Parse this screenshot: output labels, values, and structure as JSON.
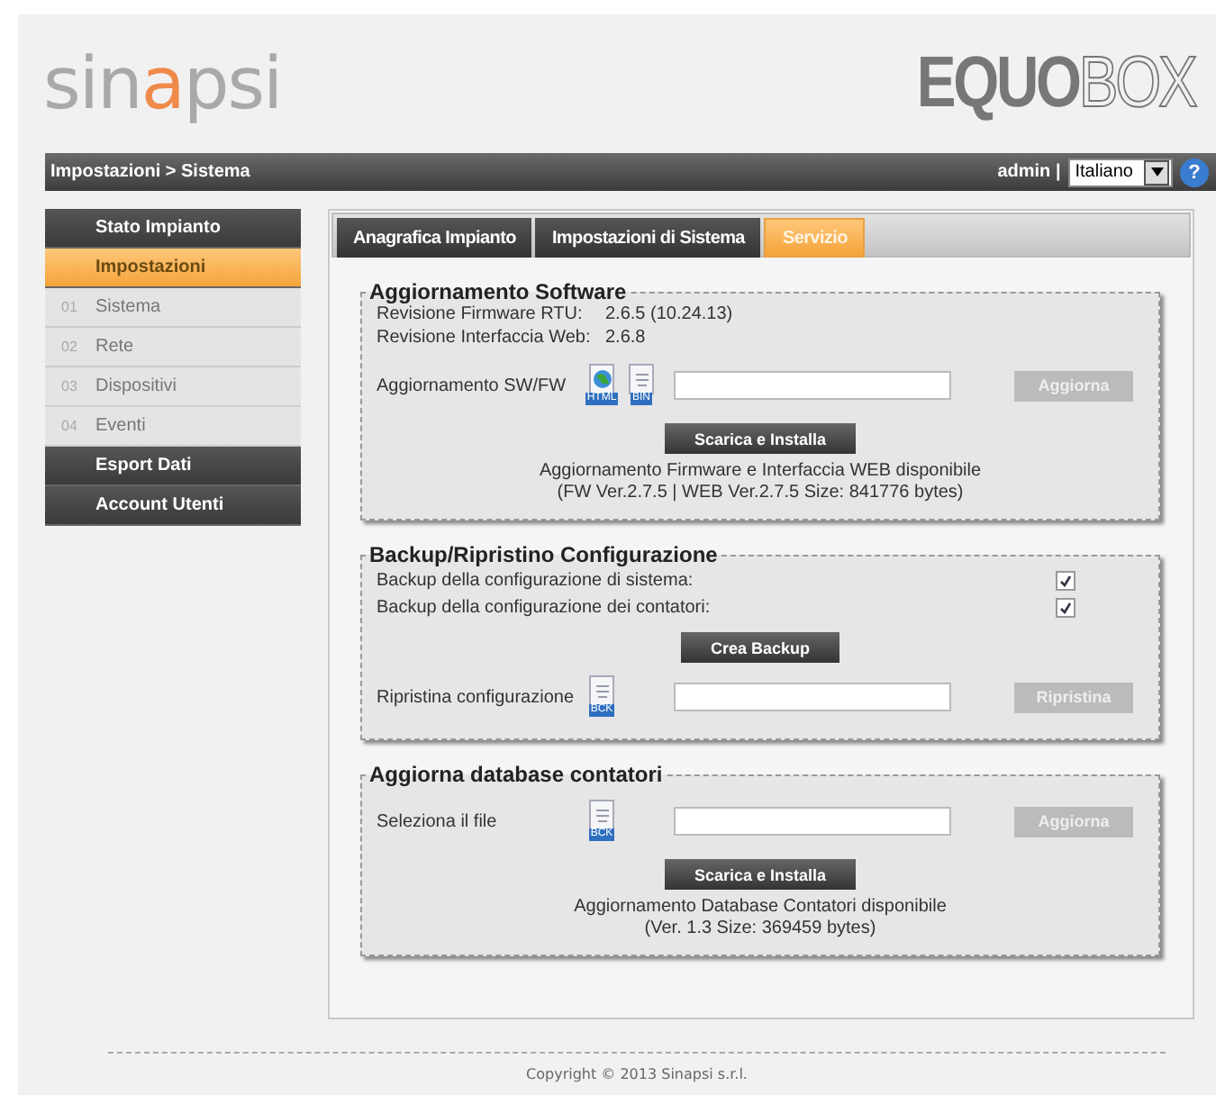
{
  "header": {
    "logo_parts": [
      "sin",
      "a",
      "psi"
    ],
    "product_parts": [
      "EQUO",
      "BOX"
    ]
  },
  "navbar": {
    "breadcrumb": "Impostazioni > Sistema",
    "user": "admin |",
    "language": "Italiano",
    "help": "?"
  },
  "sidebar": {
    "items": [
      {
        "kind": "header",
        "label": "Stato Impianto",
        "selected": false
      },
      {
        "kind": "header",
        "label": "Impostazioni",
        "selected": true
      },
      {
        "kind": "sub",
        "number": "01",
        "label": "Sistema",
        "selected": false
      },
      {
        "kind": "sub",
        "number": "02",
        "label": "Rete",
        "selected": false
      },
      {
        "kind": "sub",
        "number": "03",
        "label": "Dispositivi",
        "selected": false
      },
      {
        "kind": "sub",
        "number": "04",
        "label": "Eventi",
        "selected": false
      },
      {
        "kind": "header",
        "label": "Esport Dati",
        "selected": false
      },
      {
        "kind": "header",
        "label": "Account Utenti",
        "selected": false
      }
    ]
  },
  "tabs": [
    {
      "label": "Anagrafica Impianto",
      "selected": false
    },
    {
      "label": "Impostazioni di Sistema",
      "selected": false
    },
    {
      "label": "Servizio",
      "selected": true
    }
  ],
  "sections": [
    {
      "title": "Aggiornamento Software",
      "rows": [
        {
          "kind": "info",
          "label": "Revisione Firmware RTU:",
          "value": "2.6.5 (10.24.13)"
        },
        {
          "kind": "info",
          "label": "Revisione Interfaccia Web:",
          "value": "2.6.8"
        },
        {
          "kind": "file",
          "label": "Aggiornamento SW/FW",
          "icons": [
            {
              "tag": "HTML",
              "kind": "globe"
            },
            {
              "tag": "BIN",
              "kind": "doc"
            }
          ],
          "button": {
            "label": "Aggiorna",
            "disabled": true
          }
        },
        {
          "kind": "action",
          "button": {
            "label": "Scarica e Installa",
            "disabled": false
          }
        },
        {
          "kind": "note",
          "lines": [
            "Aggiornamento Firmware e Interfaccia WEB disponibile",
            "(FW Ver.2.7.5 | WEB Ver.2.7.5 Size: 841776 bytes)"
          ]
        }
      ]
    },
    {
      "title": "Backup/Ripristino Configurazione",
      "rows": [
        {
          "kind": "check",
          "label": "Backup della configurazione di sistema:",
          "checked": true
        },
        {
          "kind": "check",
          "label": "Backup della configurazione dei contatori:",
          "checked": true
        },
        {
          "kind": "action",
          "button": {
            "label": "Crea Backup",
            "disabled": false
          }
        },
        {
          "kind": "file",
          "label": "Ripristina configurazione",
          "icons": [
            {
              "tag": "BCK",
              "kind": "doc"
            }
          ],
          "button": {
            "label": "Ripristina",
            "disabled": true
          }
        }
      ]
    },
    {
      "title": "Aggiorna database contatori",
      "rows": [
        {
          "kind": "file",
          "label": "Seleziona il file",
          "icons": [
            {
              "tag": "BCK",
              "kind": "doc"
            }
          ],
          "button": {
            "label": "Aggiorna",
            "disabled": true
          }
        },
        {
          "kind": "action",
          "button": {
            "label": "Scarica e Installa",
            "disabled": false
          }
        },
        {
          "kind": "note",
          "lines": [
            "Aggiornamento Database Contatori disponibile",
            "(Ver. 1.3 Size: 369459 bytes)"
          ]
        }
      ]
    }
  ],
  "footer": {
    "copyright": "Copyright © 2013 Sinapsi s.r.l."
  }
}
